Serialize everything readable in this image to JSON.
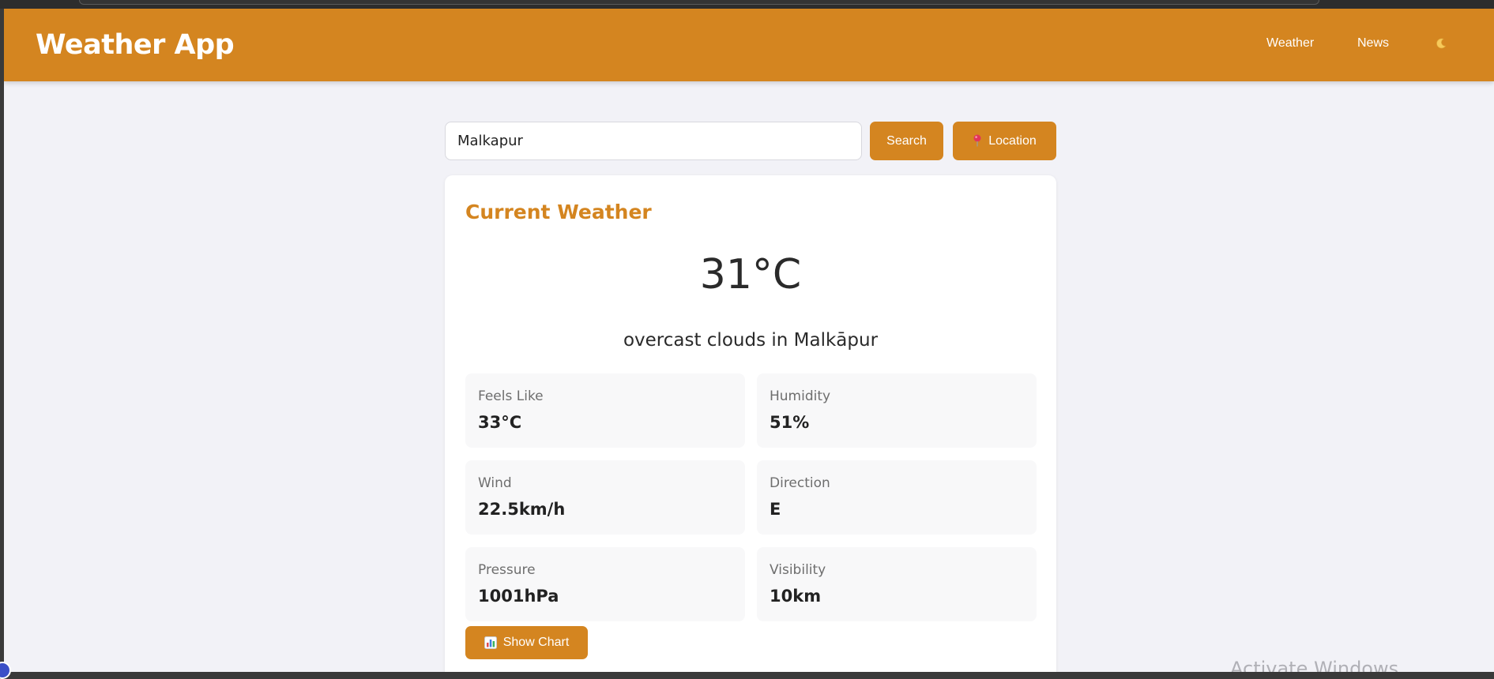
{
  "app": {
    "title": "Weather App"
  },
  "nav": {
    "weather_label": "Weather",
    "news_label": "News",
    "theme_icon": "moon-icon"
  },
  "search": {
    "value": "Malkapur",
    "button_label": "Search",
    "location_label": "Location",
    "location_icon": "map-pin-icon"
  },
  "current": {
    "section_title": "Current Weather",
    "temperature": "31°C",
    "description": "overcast clouds in Malkāpur",
    "stats": [
      {
        "label": "Feels Like",
        "value": "33°C"
      },
      {
        "label": "Humidity",
        "value": "51%"
      },
      {
        "label": "Wind",
        "value": "22.5km/h"
      },
      {
        "label": "Direction",
        "value": "E"
      },
      {
        "label": "Pressure",
        "value": "1001hPa"
      },
      {
        "label": "Visibility",
        "value": "10km"
      }
    ],
    "chart_button_label": "Show Chart",
    "chart_icon": "bar-chart-icon"
  },
  "os": {
    "watermark": "Activate Windows"
  },
  "colors": {
    "accent": "#d48520",
    "background": "#f2f2f7",
    "card": "#ffffff"
  }
}
